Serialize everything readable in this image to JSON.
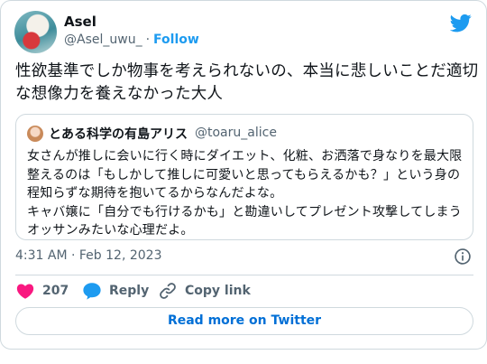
{
  "author": {
    "name": "Asel",
    "handle": "@Asel_uwu_",
    "separator": "·",
    "follow_label": "Follow"
  },
  "tweet": {
    "text": "性欲基準でしか物事を考えられないの、本当に悲しいことだ適切な想像力を養えなかった大人",
    "timestamp": "4:31 AM · Feb 12, 2023"
  },
  "quoted": {
    "name": "とある科学の有島アリス",
    "handle": "@toaru_alice",
    "text": "女さんが推しに会いに行く時にダイエット、化粧、お洒落で身なりを最大限整えるのは「もしかして推しに可愛いと思ってもらえるかも？」という身の程知らずな期待を抱いてるからなんだよな。\nキャバ嬢に「自分でも行けるかも」と勘違いしてプレゼント攻撃してしまうオッサンみたいな心理だよ。"
  },
  "actions": {
    "like_count": "207",
    "reply_label": "Reply",
    "copy_link_label": "Copy link"
  },
  "read_more_label": "Read more on Twitter",
  "colors": {
    "brand_blue": "#1d9bf0",
    "like_red": "#f91880",
    "border": "#cfd9de",
    "secondary_text": "#536471"
  },
  "icons": [
    "twitter-bird-icon",
    "info-icon",
    "heart-icon",
    "reply-bubble-icon",
    "link-icon"
  ]
}
